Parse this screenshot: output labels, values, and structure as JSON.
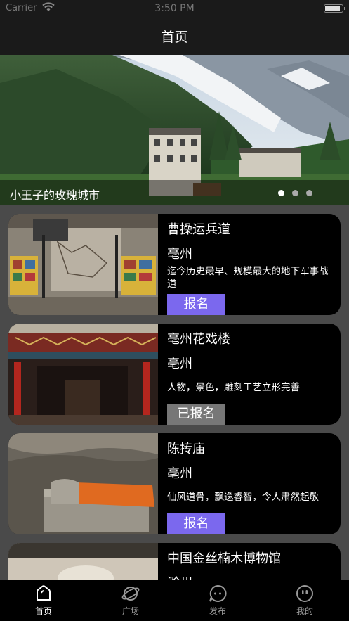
{
  "status": {
    "carrier": "Carrier",
    "time": "3:50 PM"
  },
  "nav": {
    "title": "首页"
  },
  "banner": {
    "title": "小王子的玫瑰城市",
    "page_count": 3,
    "active_page": 1
  },
  "cards": [
    {
      "title": "曹操运兵道",
      "city": "亳州",
      "desc": "迄今历史最早、规模最大的地下军事战道",
      "button": "报名",
      "button_state": "signup"
    },
    {
      "title": "亳州花戏楼",
      "city": "亳州",
      "desc": "人物，景色，雕刻工艺立形完善",
      "button": "已报名",
      "button_state": "done"
    },
    {
      "title": "陈抟庙",
      "city": "亳州",
      "desc": "仙风道骨，飘逸睿智，令人肃然起敬",
      "button": "报名",
      "button_state": "signup"
    },
    {
      "title": "中国金丝楠木博物馆",
      "city": "滁州"
    }
  ],
  "tabs": [
    {
      "label": "首页",
      "icon": "home-icon",
      "active": true
    },
    {
      "label": "广场",
      "icon": "planet-icon",
      "active": false
    },
    {
      "label": "发布",
      "icon": "chat-bubble-icon",
      "active": false
    },
    {
      "label": "我的",
      "icon": "smiley-icon",
      "active": false
    }
  ],
  "colors": {
    "accent": "#7b68ee",
    "disabled": "#777777",
    "background": "#1a1a1a",
    "list_bg": "#4a4a4a"
  }
}
